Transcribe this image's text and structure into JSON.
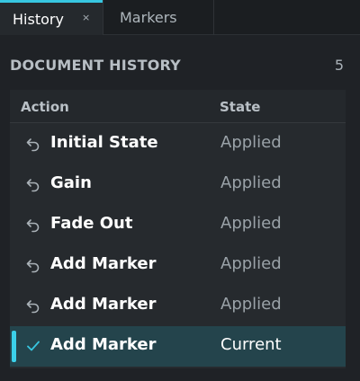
{
  "tabs": {
    "history": {
      "label": "History",
      "close": "×"
    },
    "markers": {
      "label": "Markers"
    }
  },
  "section": {
    "title": "DOCUMENT HISTORY",
    "count": "5"
  },
  "table": {
    "headers": {
      "action": "Action",
      "state": "State"
    },
    "rows": [
      {
        "action": "Initial State",
        "state": "Applied",
        "icon": "undo-icon"
      },
      {
        "action": "Gain",
        "state": "Applied",
        "icon": "undo-icon"
      },
      {
        "action": "Fade Out",
        "state": "Applied",
        "icon": "undo-icon"
      },
      {
        "action": "Add Marker",
        "state": "Applied",
        "icon": "undo-icon"
      },
      {
        "action": "Add Marker",
        "state": "Applied",
        "icon": "undo-icon"
      },
      {
        "action": "Add Marker",
        "state": "Current",
        "icon": "checkmark-icon"
      }
    ]
  },
  "colors": {
    "accent": "#37c6e0",
    "current_row": "#24444c"
  }
}
